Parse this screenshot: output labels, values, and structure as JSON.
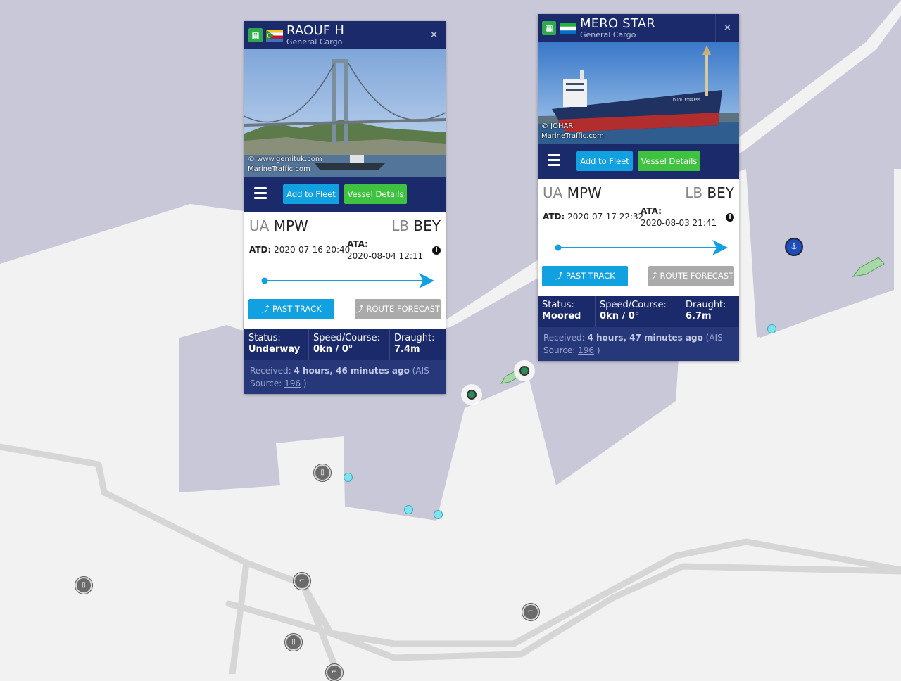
{
  "colors": {
    "water": "#c8c8d8",
    "land": "#f2f2f2",
    "road": "#d6d6d6",
    "header": "#1b2a6b",
    "accent_blue": "#12a1e0",
    "accent_green": "#3fc23f",
    "poi": "#6b6b6b",
    "buoy": "#7ee3ef"
  },
  "map": {
    "icons": {
      "poi": "building-icon",
      "crane": "crane-icon",
      "harbour": "harbour-icon",
      "buoy": "buoy-dot",
      "vessel_moored": "moored-vessel-icon",
      "vessel_underway": "vessel-arrow-icon"
    }
  },
  "popups": [
    {
      "name": "RAOUF H",
      "type": "General Cargo",
      "flag": "comoros",
      "photo_credit": "© www.gemituk.com",
      "photo_site": "MarineTraffic.com",
      "add_to_fleet": "Add to Fleet",
      "vessel_details": "Vessel Details",
      "from_country": "UA",
      "from_port": "MPW",
      "to_country": "LB",
      "to_port": "BEY",
      "atd_label": "ATD:",
      "atd_value": "2020-07-16 20:40",
      "ata_label": "ATA:",
      "ata_value": "2020-08-04 12:11",
      "past_track": "PAST TRACK",
      "route_forecast": "ROUTE FORECAST",
      "status_label": "Status:",
      "status_value": "Underway",
      "speed_label": "Speed/Course:",
      "speed_value": "0kn / 0°",
      "draught_label": "Draught:",
      "draught_value": "7.4m",
      "received_label": "Received:",
      "received_value": "4 hours, 46 minutes ago",
      "ais_label": "(AIS Source:",
      "ais_value": "196",
      "ais_close": ")"
    },
    {
      "name": "MERO STAR",
      "type": "General Cargo",
      "flag": "sierra-leone",
      "photo_credit": "© JOHAR",
      "photo_site": "MarineTraffic.com",
      "add_to_fleet": "Add to Fleet",
      "vessel_details": "Vessel Details",
      "from_country": "UA",
      "from_port": "MPW",
      "to_country": "LB",
      "to_port": "BEY",
      "atd_label": "ATD:",
      "atd_value": "2020-07-17 22:32",
      "ata_label": "ATA:",
      "ata_value": "2020-08-03 21:41",
      "past_track": "PAST TRACK",
      "route_forecast": "ROUTE FORECAST",
      "status_label": "Status:",
      "status_value": "Moored",
      "speed_label": "Speed/Course:",
      "speed_value": "0kn / 0°",
      "draught_label": "Draught:",
      "draught_value": "6.7m",
      "received_label": "Received:",
      "received_value": "4 hours, 47 minutes ago",
      "ais_label": "(AIS Source:",
      "ais_value": "196",
      "ais_close": ")"
    }
  ]
}
